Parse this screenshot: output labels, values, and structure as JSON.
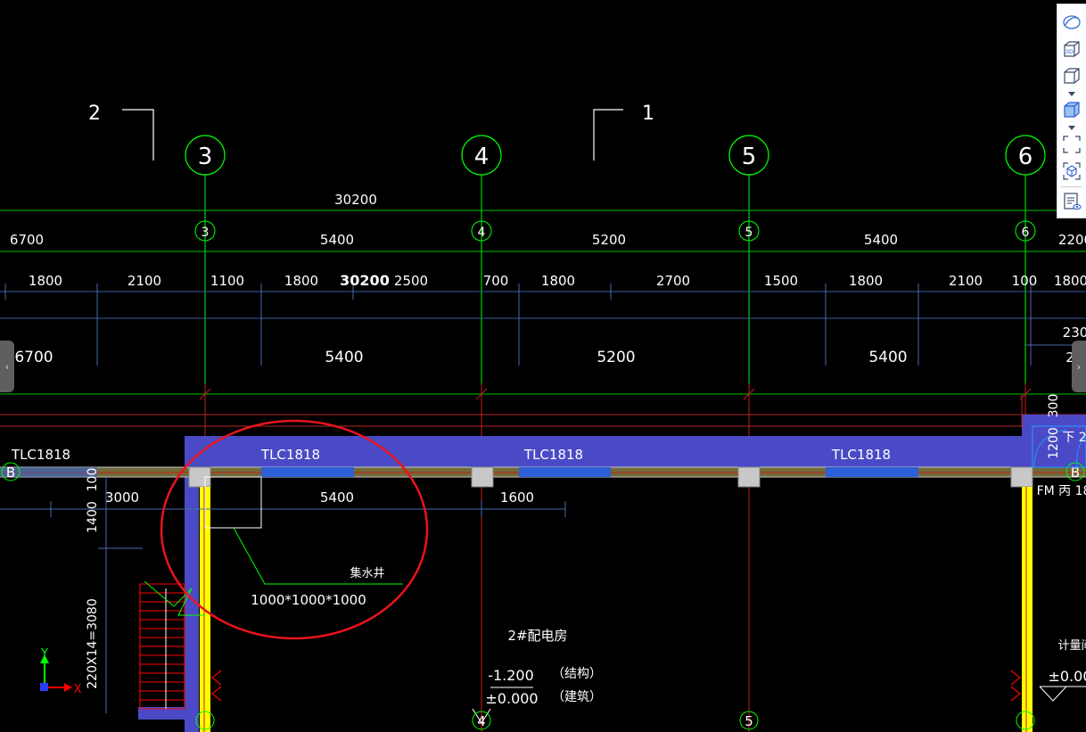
{
  "colors": {
    "background": "#000000",
    "grid_axis": "#00ff00",
    "dimension_line": "#00c800",
    "wall": "#4a4ac6",
    "column": "#c8c8c8",
    "stair": "#ff0000",
    "highlight_circle": "#e8141c",
    "yellow_wall": "#ffff00"
  },
  "drawing": {
    "section_markers": [
      "2",
      "1"
    ],
    "grid_axes_top": [
      "3",
      "4",
      "5",
      "6"
    ],
    "grid_axes_small": [
      "3",
      "4",
      "5",
      "6"
    ],
    "grid_axes_bottom": [
      "4",
      "5"
    ],
    "row_axis": "B",
    "overall_dimension": "30200",
    "overall_dimension_mid": "30200",
    "dim_row1": [
      "6700",
      "5400",
      "5200",
      "5400",
      "2200"
    ],
    "dim_row2": [
      "1800",
      "2100",
      "1100",
      "1800",
      "2500",
      "700",
      "1800",
      "2700",
      "1500",
      "1800",
      "2100",
      "100",
      "1800"
    ],
    "dim_row3": [
      "6700",
      "5400",
      "5200",
      "5400"
    ],
    "right_dims": [
      "230",
      "2"
    ],
    "right_vert_dims": [
      "300",
      "1200"
    ],
    "window_labels": [
      "TLC1818",
      "TLC1818",
      "TLC1818",
      "TLC1818"
    ],
    "below_dims": [
      "3000",
      "5400",
      "1600"
    ],
    "left_vert_dims": [
      "100",
      "1400",
      "220X14=3080"
    ],
    "sump_label": "集水井",
    "sump_size": "1000*1000*1000",
    "room_name": "2#配电房",
    "elevation_structural": "-1.200",
    "elevation_structural_note": "（结构）",
    "elevation_architectural": "±0.000",
    "elevation_architectural_note": "（建筑）",
    "right_partial_label": "下 2",
    "fire_door_label": "FM 丙 18",
    "meter_room_label": "计量间",
    "right_elevation": "±0.00",
    "ucs": {
      "x_label": "X",
      "y_label": "Y"
    }
  },
  "toolbar": {
    "items": [
      {
        "name": "orbit-icon"
      },
      {
        "name": "3d-view-icon",
        "text": "3D"
      },
      {
        "name": "view-cube-icon"
      },
      {
        "name": "shaded-cube-icon"
      },
      {
        "name": "zoom-extents-icon"
      },
      {
        "name": "isometric-view-icon"
      },
      {
        "name": "properties-panel-icon"
      }
    ]
  },
  "side_tabs": {
    "left_glyph": "‹",
    "right_glyph": "›"
  }
}
